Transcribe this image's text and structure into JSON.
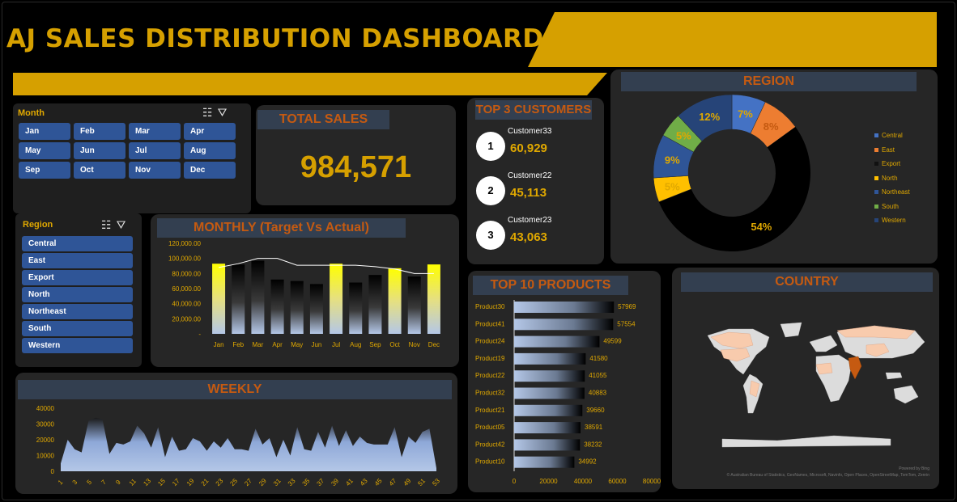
{
  "title": "AJ SALES DISTRIBUTION DASHBOARD",
  "colors": {
    "accent": "#d6a000",
    "orange": "#c55a11",
    "blue_button": "#2f5597",
    "title_bar": "#333f50",
    "panel": "#262626"
  },
  "month_slicer": {
    "header": "Month",
    "icons": [
      "multi-select-icon",
      "clear-filter-icon"
    ],
    "months": [
      "Jan",
      "Feb",
      "Mar",
      "Apr",
      "May",
      "Jun",
      "Jul",
      "Aug",
      "Sep",
      "Oct",
      "Nov",
      "Dec"
    ]
  },
  "total_sales": {
    "label": "TOTAL SALES",
    "value": "984,571"
  },
  "top_customers": {
    "label": "TOP 3 CUSTOMERS",
    "items": [
      {
        "rank": "1",
        "name": "Customer33",
        "value": "60,929"
      },
      {
        "rank": "2",
        "name": "Customer22",
        "value": "45,113"
      },
      {
        "rank": "3",
        "name": "Customer23",
        "value": "43,063"
      }
    ]
  },
  "region_slicer": {
    "header": "Region",
    "icons": [
      "multi-select-icon",
      "clear-filter-icon"
    ],
    "regions": [
      "Central",
      "East",
      "Export",
      "North",
      "Northeast",
      "South",
      "Western"
    ]
  },
  "region_chart_title": "REGION",
  "monthly_title": "MONTHLY (Target Vs Actual)",
  "weekly_title": "WEEKLY",
  "products_title": "TOP 10 PRODUCTS",
  "country_title": "COUNTRY",
  "map_credits": {
    "powered": "Powered by Bing",
    "sources": "© Australian Bureau of Statistics, GeoNames, Microsoft, Navinfo, Open Places, OpenStreetMap, TomTom, Zenrin"
  },
  "chart_data": [
    {
      "type": "pie",
      "id": "region",
      "title": "REGION",
      "labels": [
        "Central",
        "East",
        "Export",
        "North",
        "Northeast",
        "South",
        "Western"
      ],
      "values": [
        7,
        8,
        54,
        5,
        9,
        5,
        12
      ],
      "value_labels": [
        "7%",
        "8%",
        "54%",
        "5%",
        "9%",
        "5%",
        "12%"
      ],
      "colors": [
        "#4472c4",
        "#ed7d31",
        "#000000",
        "#ffc000",
        "#2f5597",
        "#70ad47",
        "#264478"
      ],
      "donut": true,
      "legend": "right"
    },
    {
      "type": "bar",
      "id": "monthly",
      "title": "MONTHLY (Target Vs Actual)",
      "categories": [
        "Jan",
        "Feb",
        "Mar",
        "Apr",
        "May",
        "Jun",
        "Jul",
        "Aug",
        "Sep",
        "Oct",
        "Nov",
        "Dec"
      ],
      "yticks": [
        "-",
        "20,000.00",
        "40,000.00",
        "60,000.00",
        "80,000.00",
        "100,000.00",
        "120,000.00"
      ],
      "ylim": [
        0,
        120000
      ],
      "series": [
        {
          "type": "bar",
          "values": [
            93000,
            92000,
            97000,
            72000,
            70000,
            66000,
            93000,
            68000,
            78000,
            87000,
            76000,
            92000
          ]
        },
        {
          "type": "line",
          "values": [
            88000,
            93000,
            100000,
            100000,
            91000,
            91000,
            91000,
            91000,
            89000,
            86000,
            80000,
            80000
          ]
        }
      ],
      "highlight_months": [
        "Jan",
        "Jul",
        "Oct",
        "Dec"
      ]
    },
    {
      "type": "area",
      "id": "weekly",
      "title": "WEEKLY",
      "x": [
        1,
        2,
        3,
        4,
        5,
        6,
        7,
        8,
        9,
        10,
        11,
        12,
        13,
        14,
        15,
        16,
        17,
        18,
        19,
        20,
        21,
        22,
        23,
        24,
        25,
        26,
        27,
        28,
        29,
        30,
        31,
        32,
        33,
        34,
        35,
        36,
        37,
        38,
        39,
        40,
        41,
        42,
        43,
        44,
        45,
        46,
        47,
        48,
        49,
        50,
        51,
        52,
        53
      ],
      "xticks": [
        "1",
        "3",
        "5",
        "7",
        "9",
        "11",
        "13",
        "15",
        "17",
        "19",
        "21",
        "23",
        "25",
        "27",
        "29",
        "31",
        "33",
        "35",
        "37",
        "39",
        "41",
        "43",
        "45",
        "47",
        "49",
        "51",
        "53"
      ],
      "values": [
        5000,
        20000,
        14000,
        12000,
        32000,
        34000,
        33000,
        11000,
        18000,
        17000,
        19000,
        29000,
        24000,
        15000,
        28000,
        9000,
        22000,
        13000,
        14000,
        21000,
        19000,
        13000,
        19000,
        15000,
        21000,
        14000,
        14000,
        13000,
        27000,
        17000,
        21000,
        9000,
        20000,
        10000,
        28000,
        14000,
        13000,
        25000,
        15000,
        29000,
        16000,
        26000,
        16000,
        22000,
        18000,
        17000,
        17000,
        17000,
        28000,
        9000,
        22000,
        18000,
        25000,
        27000,
        2000
      ],
      "yticks": [
        "0",
        "10000",
        "20000",
        "30000",
        "40000"
      ],
      "ylim": [
        0,
        40000
      ]
    },
    {
      "type": "bar",
      "id": "top_products",
      "title": "TOP 10 PRODUCTS",
      "orientation": "horizontal",
      "categories": [
        "Product30",
        "Product41",
        "Product24",
        "Product19",
        "Product22",
        "Product32",
        "Product21",
        "Product05",
        "Product42",
        "Product10"
      ],
      "values": [
        57969,
        57554,
        49599,
        41580,
        41055,
        40883,
        39660,
        38591,
        38232,
        34992
      ],
      "xticks": [
        "0",
        "20000",
        "40000",
        "60000",
        "80000"
      ],
      "xlim": [
        0,
        80000
      ]
    }
  ]
}
